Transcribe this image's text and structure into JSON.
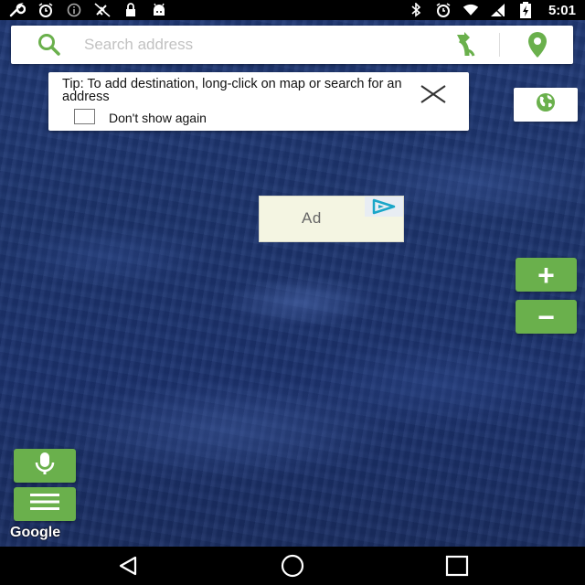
{
  "status_bar": {
    "time": "5:01",
    "icons_left": [
      "wrench-icon",
      "alarm-icon",
      "info-icon",
      "gps-off-icon",
      "lock-icon",
      "android-icon"
    ],
    "icons_right": [
      "bluetooth-icon",
      "alarm-icon",
      "wifi-icon",
      "signal-icon",
      "battery-charging-icon"
    ]
  },
  "search": {
    "placeholder": "Search address",
    "value": ""
  },
  "tip": {
    "text": "Tip: To add destination, long-click on map or search for an address",
    "checkbox_label": "Don't show again",
    "checked": false
  },
  "ad": {
    "label": "Ad"
  },
  "map": {
    "attribution": "Google",
    "accent_color": "#6ab04c"
  },
  "zoom": {
    "in_label": "+",
    "out_label": "−"
  }
}
